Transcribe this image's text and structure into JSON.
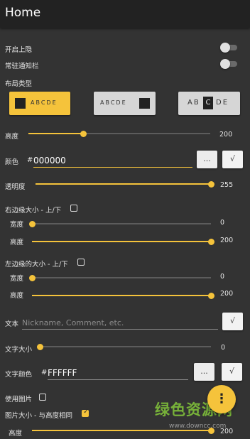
{
  "appbar": {
    "title": "Home"
  },
  "toggles": [
    {
      "label": "开启上隐",
      "on": false
    },
    {
      "label": "常驻通知栏",
      "on": false
    }
  ],
  "layout": {
    "label": "布局类型",
    "options": [
      {
        "text": "ABCDE",
        "selected": true,
        "bg": "#f5c33b",
        "swatch": "#222222"
      },
      {
        "text": "ABCDE",
        "selected": false,
        "bg": "#d6d6d6",
        "swatch": "#222222"
      },
      {
        "text_left": "AB",
        "text_mid": "C",
        "text_right": "DE",
        "selected": false,
        "bg": "#d6d6d6"
      }
    ]
  },
  "height": {
    "label": "高度",
    "value": "200",
    "fraction": 0.3
  },
  "color": {
    "label": "颜色",
    "hash": "#",
    "value": "000000",
    "dots": "...",
    "ok": "√"
  },
  "opacity": {
    "label": "透明度",
    "value": "255",
    "fraction": 1.0
  },
  "right_edge": {
    "label": "右边缘大小 - 上/下",
    "checked": false,
    "width": {
      "label": "宽度",
      "value": "0",
      "fraction": 0.0
    },
    "height": {
      "label": "高度",
      "value": "200",
      "fraction": 1.0
    }
  },
  "left_edge": {
    "label": "左边缘的大小 - 上/下",
    "checked": false,
    "width": {
      "label": "宽度",
      "value": "0",
      "fraction": 0.0
    },
    "height": {
      "label": "高度",
      "value": "200",
      "fraction": 1.0
    }
  },
  "text": {
    "label": "文本",
    "placeholder": "Nickname, Comment, etc.",
    "ok": "√"
  },
  "text_size": {
    "label": "文字大小",
    "value": "0",
    "fraction": 0.0
  },
  "text_color": {
    "label": "文字颜色",
    "hash": "#",
    "value": "FFFFFF",
    "dots": "...",
    "ok": "√"
  },
  "use_image": {
    "label": "使用图片",
    "checked": false
  },
  "image_size": {
    "label": "图片大小 - 与高度相同",
    "checked": true
  },
  "image_height": {
    "label": "高度",
    "value": "200",
    "fraction": 1.0
  },
  "fab": {
    "icon": "more-vert-icon",
    "glyph": "⋮"
  },
  "watermark": {
    "text": "绿色资源网",
    "url": "www.downcc.com"
  },
  "colors": {
    "accent": "#f5c33b",
    "background": "#333333",
    "appbar": "#222222"
  }
}
